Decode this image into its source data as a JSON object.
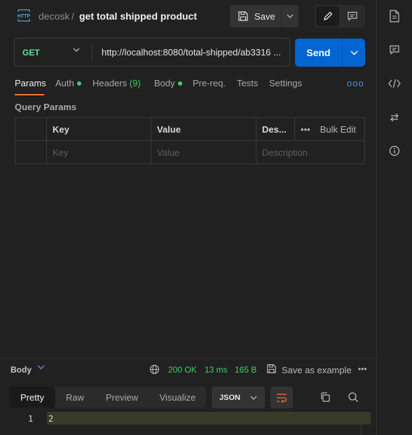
{
  "header": {
    "http_badge": "HTTP",
    "parent": "decosk",
    "separator": "/",
    "title": "get total shipped product",
    "save_label": "Save"
  },
  "request": {
    "method": "GET",
    "url": "http://localhost:8080/total-shipped/ab3316 ...",
    "send_label": "Send"
  },
  "tabs": {
    "params": "Params",
    "auth": "Auth",
    "headers": "Headers",
    "headers_count": "(9)",
    "body": "Body",
    "prereq": "Pre-req.",
    "tests": "Tests",
    "settings": "Settings",
    "more": "ooo"
  },
  "query_params": {
    "title": "Query Params",
    "columns": [
      "Key",
      "Value",
      "Des..."
    ],
    "bulk_edit": "Bulk Edit",
    "more": "•••",
    "placeholders": [
      "Key",
      "Value",
      "Description"
    ]
  },
  "response": {
    "body_label": "Body",
    "status": "200 OK",
    "time": "13 ms",
    "size": "165 B",
    "save_example": "Save as example",
    "more": "•••",
    "view_tabs": [
      "Pretty",
      "Raw",
      "Preview",
      "Visualize"
    ],
    "format": "JSON",
    "line_numbers": [
      "1"
    ],
    "lines": [
      "2"
    ]
  },
  "colors": {
    "accent": "#ff6c37",
    "send": "#0265d2",
    "method": "#6bdd9a",
    "ok": "#3ecf6f"
  },
  "rightbar_icons": [
    "document-icon",
    "comment-icon",
    "code-icon",
    "arrows-icon",
    "info-icon"
  ]
}
